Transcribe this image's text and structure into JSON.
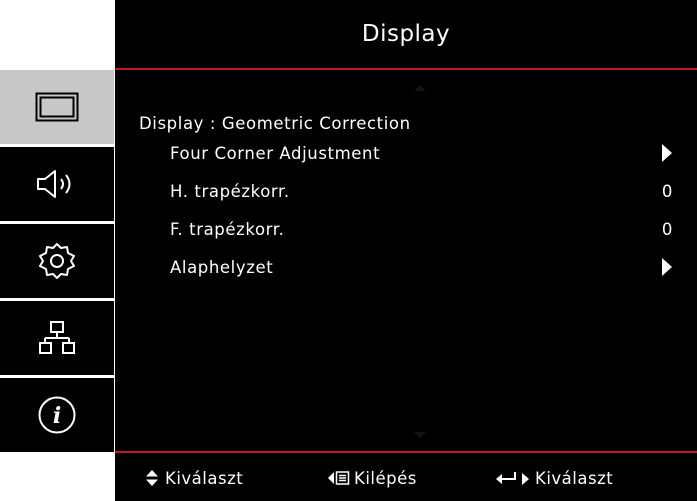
{
  "window": {
    "title": "Display"
  },
  "sidebar": {
    "tabs": [
      {
        "name": "display",
        "icon": "display-icon",
        "active": true
      },
      {
        "name": "audio",
        "icon": "speaker-icon",
        "active": false
      },
      {
        "name": "setup",
        "icon": "gear-icon",
        "active": false
      },
      {
        "name": "network",
        "icon": "network-icon",
        "active": false
      },
      {
        "name": "info",
        "icon": "info-icon",
        "active": false
      }
    ]
  },
  "menu": {
    "section_title": "Display : Geometric Correction",
    "items": [
      {
        "label": "Four Corner Adjustment",
        "control": "submenu-arrow"
      },
      {
        "label": "H. trapézkorr.",
        "value": "0"
      },
      {
        "label": "F. trapézkorr.",
        "value": "0"
      },
      {
        "label": "Alaphelyzet",
        "control": "submenu-arrow"
      }
    ]
  },
  "footer": {
    "select_label": "Kiválaszt",
    "exit_label": "Kilépés",
    "enter_label": "Kiválaszt"
  },
  "colors": {
    "accent": "#c8141e",
    "background": "#000000",
    "active_tab": "#c8c8c8"
  }
}
